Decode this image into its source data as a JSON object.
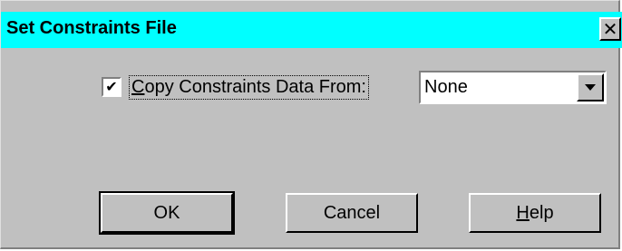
{
  "dialog": {
    "title": "Set Constraints File",
    "close_glyph": "✕",
    "close_icon": "close-icon"
  },
  "copy_checkbox": {
    "checked": true,
    "check_glyph": "✔",
    "label_underlined": "C",
    "label_rest": "opy Constraints Data From:"
  },
  "source_combo": {
    "value": "None",
    "dropdown_icon": "chevron-down-icon"
  },
  "buttons": {
    "ok": "OK",
    "cancel": "Cancel",
    "help_underlined": "H",
    "help_rest": "elp"
  },
  "colors": {
    "titlebar": "#00ffff",
    "face": "#c0c0c0"
  }
}
